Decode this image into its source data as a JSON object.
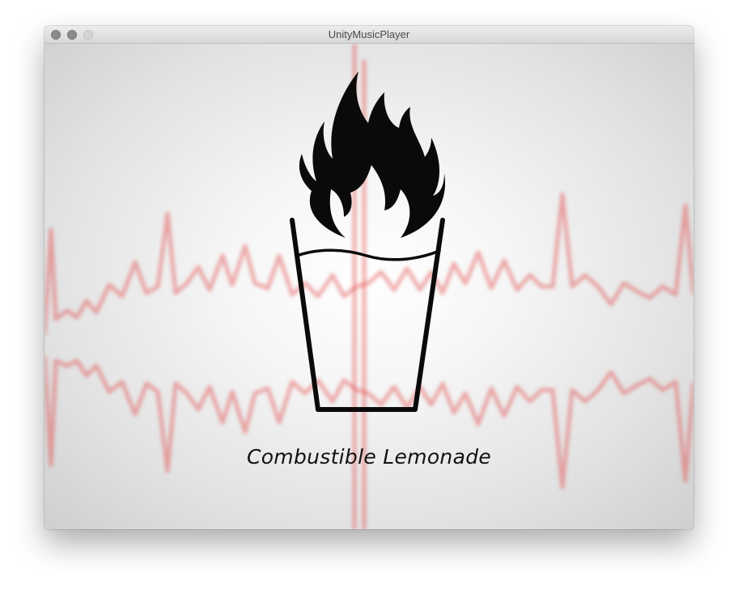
{
  "window": {
    "title": "UnityMusicPlayer"
  },
  "player": {
    "track_title": "Combustible Lemonade",
    "logo_icon": "flaming-lemonade-cup-icon",
    "background_icon": "audio-waveform-visualizer",
    "waveform_color": "#e24a4a"
  }
}
